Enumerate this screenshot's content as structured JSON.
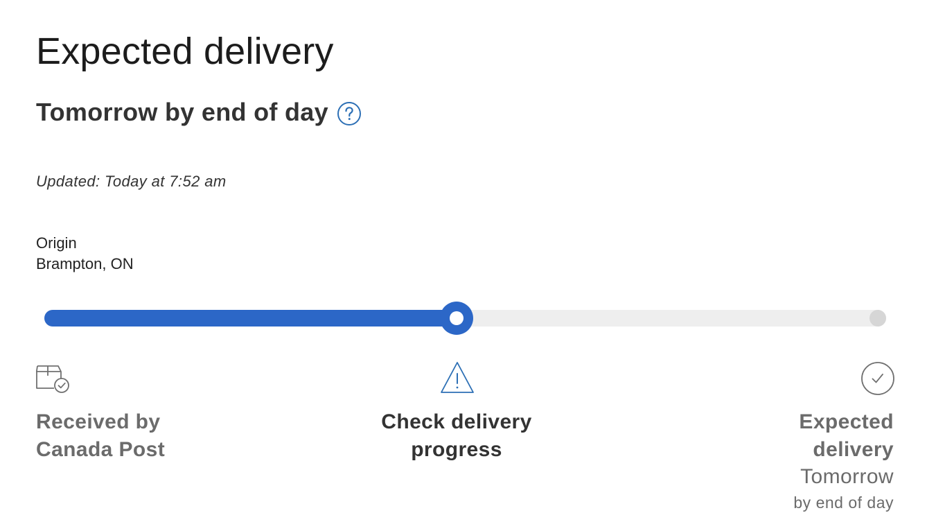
{
  "header": {
    "title": "Expected delivery",
    "eta": "Tomorrow by end of day",
    "help_icon": "question-circle-icon",
    "updated": "Updated: Today at 7:52 am"
  },
  "origin": {
    "label": "Origin",
    "location": "Brampton, ON"
  },
  "progress": {
    "fraction": 0.49,
    "accent_color": "#2c67c7",
    "track_color": "#eeeeee"
  },
  "steps": [
    {
      "icon": "package-check-icon",
      "label": "Received by Canada Post"
    },
    {
      "icon": "warning-triangle-icon",
      "label": "Check delivery progress"
    },
    {
      "icon": "check-circle-icon",
      "label": "Expected delivery",
      "date": "Tomorrow",
      "sub": "by end of day"
    }
  ]
}
